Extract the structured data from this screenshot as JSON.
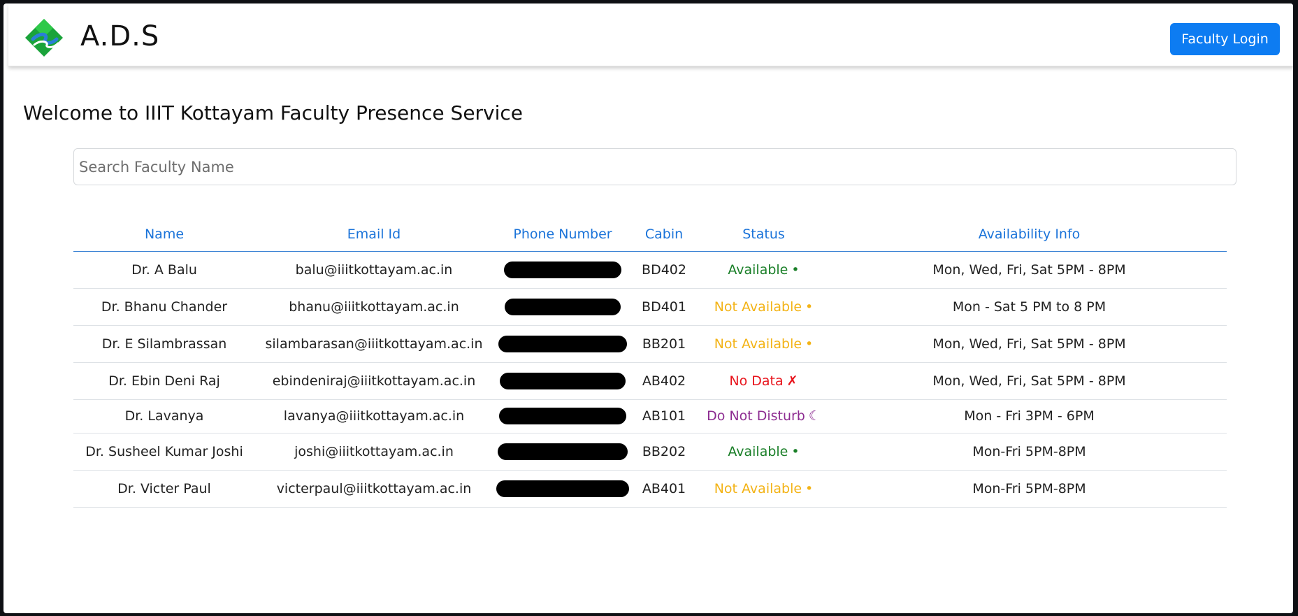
{
  "brand": {
    "name": "A.D.S",
    "logo_icon": "ads-logo-icon"
  },
  "nav": {
    "login_label": "Faculty Login"
  },
  "page": {
    "title": "Welcome to IIIT Kottayam Faculty Presence Service"
  },
  "search": {
    "placeholder": "Search Faculty Name",
    "value": ""
  },
  "table": {
    "headers": [
      "Name",
      "Email Id",
      "Phone Number",
      "Cabin",
      "Status",
      "Availability Info"
    ],
    "rows": [
      {
        "name": "Dr. A Balu",
        "email": "balu@iiitkottayam.ac.in",
        "cabin": "BD402",
        "status": "Available",
        "status_icon": "•",
        "availability": "Mon, Wed, Fri, Sat 5PM - 8PM"
      },
      {
        "name": "Dr. Bhanu Chander",
        "email": "bhanu@iiitkottayam.ac.in",
        "cabin": "BD401",
        "status": "Not Available",
        "status_icon": "•",
        "availability": "Mon - Sat 5 PM to 8 PM"
      },
      {
        "name": "Dr. E Silambrassan",
        "email": "silambarasan@iiitkottayam.ac.in",
        "cabin": "BB201",
        "status": "Not Available",
        "status_icon": "•",
        "availability": "Mon, Wed, Fri, Sat 5PM - 8PM"
      },
      {
        "name": "Dr. Ebin Deni Raj",
        "email": "ebindeniraj@iiitkottayam.ac.in",
        "cabin": "AB402",
        "status": "No Data",
        "status_icon": "✗",
        "availability": "Mon, Wed, Fri, Sat 5PM - 8PM"
      },
      {
        "name": "Dr. Lavanya",
        "email": "lavanya@iiitkottayam.ac.in",
        "cabin": "AB101",
        "status": "Do Not Disturb",
        "status_icon": "☾",
        "availability": "Mon - Fri 3PM - 6PM"
      },
      {
        "name": "Dr. Susheel Kumar Joshi",
        "email": "joshi@iiitkottayam.ac.in",
        "cabin": "BB202",
        "status": "Available",
        "status_icon": "•",
        "availability": "Mon-Fri 5PM-8PM"
      },
      {
        "name": "Dr. Victer Paul",
        "email": "victerpaul@iiitkottayam.ac.in",
        "cabin": "AB401",
        "status": "Not Available",
        "status_icon": "•",
        "availability": "Mon-Fri 5PM-8PM"
      }
    ]
  },
  "colors": {
    "accent": "#0d7cf2",
    "header_text": "#1a73d9",
    "available": "#1a7f28",
    "not_available": "#f3b316",
    "no_data": "#e8141c",
    "do_not_disturb": "#8d2c91",
    "redaction": "#000000"
  }
}
